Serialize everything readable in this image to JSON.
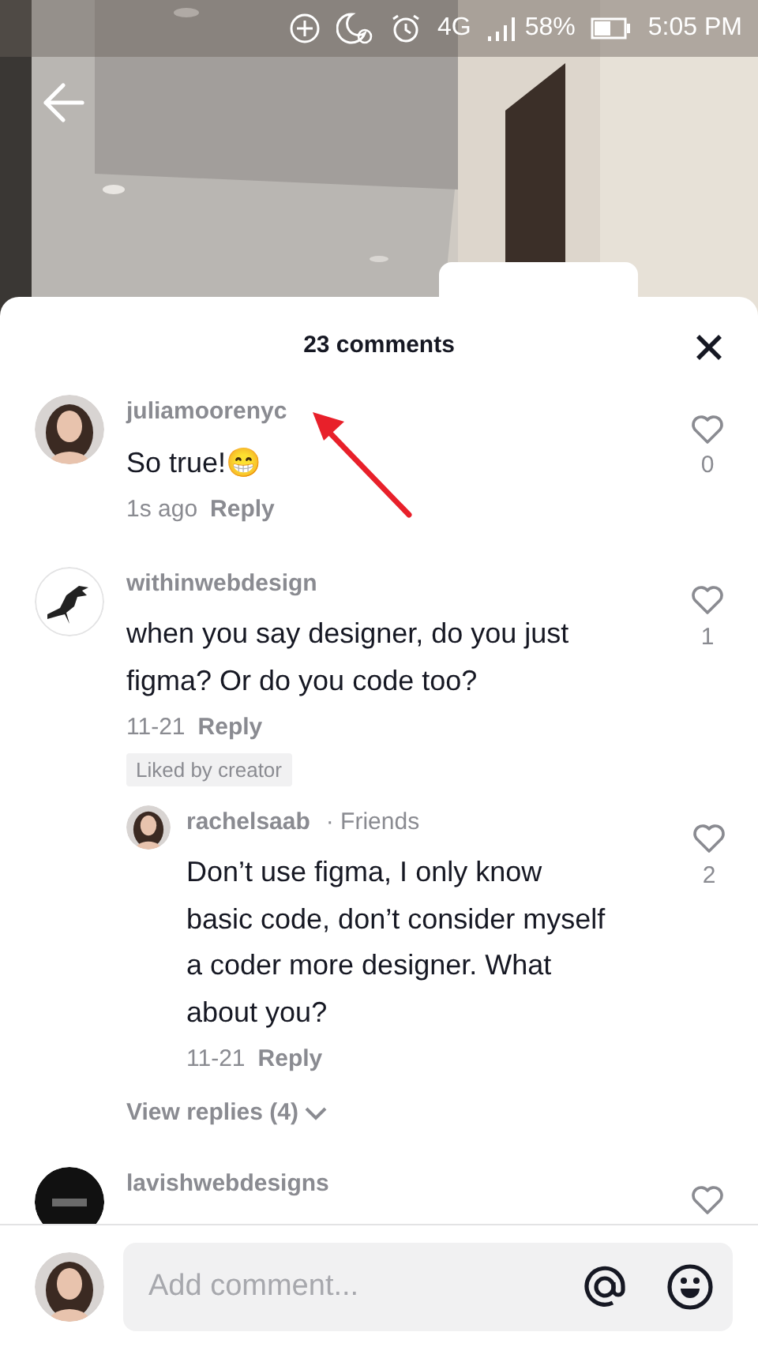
{
  "status_bar": {
    "network": "4G",
    "battery": "58%",
    "time": "5:05 PM"
  },
  "sheet": {
    "title": "23 comments"
  },
  "comments": [
    {
      "user": "juliamoorenyc",
      "avatar": {
        "kind": "person"
      },
      "text": "So true!😁",
      "time": "1s ago",
      "reply": "Reply",
      "likes": "0",
      "liked": false
    },
    {
      "user": "withinwebdesign",
      "avatar": {
        "kind": "bird"
      },
      "text": "when you say designer, do you just figma? Or do you code too?",
      "time": "11-21",
      "reply": "Reply",
      "likes": "1",
      "liked": false,
      "badge": "Liked by creator",
      "replies": [
        {
          "user": "rachelsaab",
          "tag": "· Friends",
          "avatar": {
            "kind": "person"
          },
          "text": "Don’t use figma, I only know basic code, don’t consider myself a coder more designer. What about you?",
          "time": "11-21",
          "reply": "Reply",
          "likes": "2",
          "liked": false
        }
      ],
      "view_replies": "View replies (4)"
    },
    {
      "user": "lavishwebdesigns",
      "avatar": {
        "kind": "dark"
      },
      "liked": false
    }
  ],
  "composer": {
    "placeholder": "Add comment..."
  }
}
